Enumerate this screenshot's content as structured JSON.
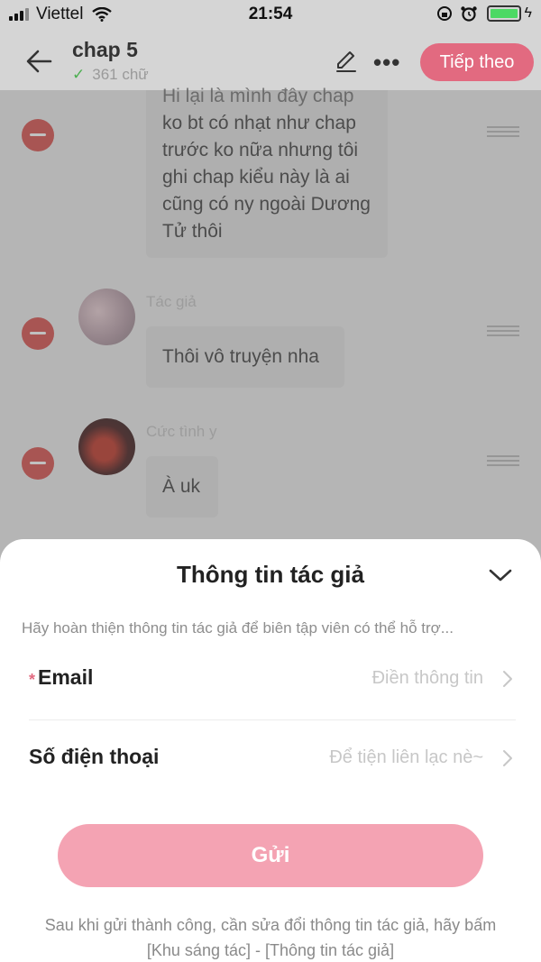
{
  "status_bar": {
    "carrier": "Viettel",
    "time": "21:54"
  },
  "header": {
    "title": "chap 5",
    "word_count": "361 chữ",
    "next_label": "Tiếp theo",
    "accent_color": "#e26a80"
  },
  "messages": [
    {
      "author": "",
      "text_cut": "Hi lại là mình đây chap",
      "text": "ko bt có nhạt như chap trước ko nữa nhưng tôi ghi chap kiểu này là ai cũng có ny ngoài Dương Tử thôi"
    },
    {
      "author": "Tác giả",
      "text": "Thôi vô truyện nha"
    },
    {
      "author": "Cức tình y",
      "text": "À uk"
    }
  ],
  "sheet": {
    "title": "Thông tin tác giả",
    "hint": "Hãy hoàn thiện thông tin tác giả để biên tập viên có thể hỗ trợ...",
    "fields": [
      {
        "required_mark": "*",
        "label": "Email",
        "placeholder": "Điền thông tin"
      },
      {
        "label": "Số điện thoại",
        "placeholder": "Để tiện liên lạc nè~"
      }
    ],
    "submit_label": "Gửi",
    "note": "Sau khi gửi thành công, cần sửa đổi thông tin tác giả, hãy bấm [Khu sáng tác] - [Thông tin tác giả]"
  }
}
